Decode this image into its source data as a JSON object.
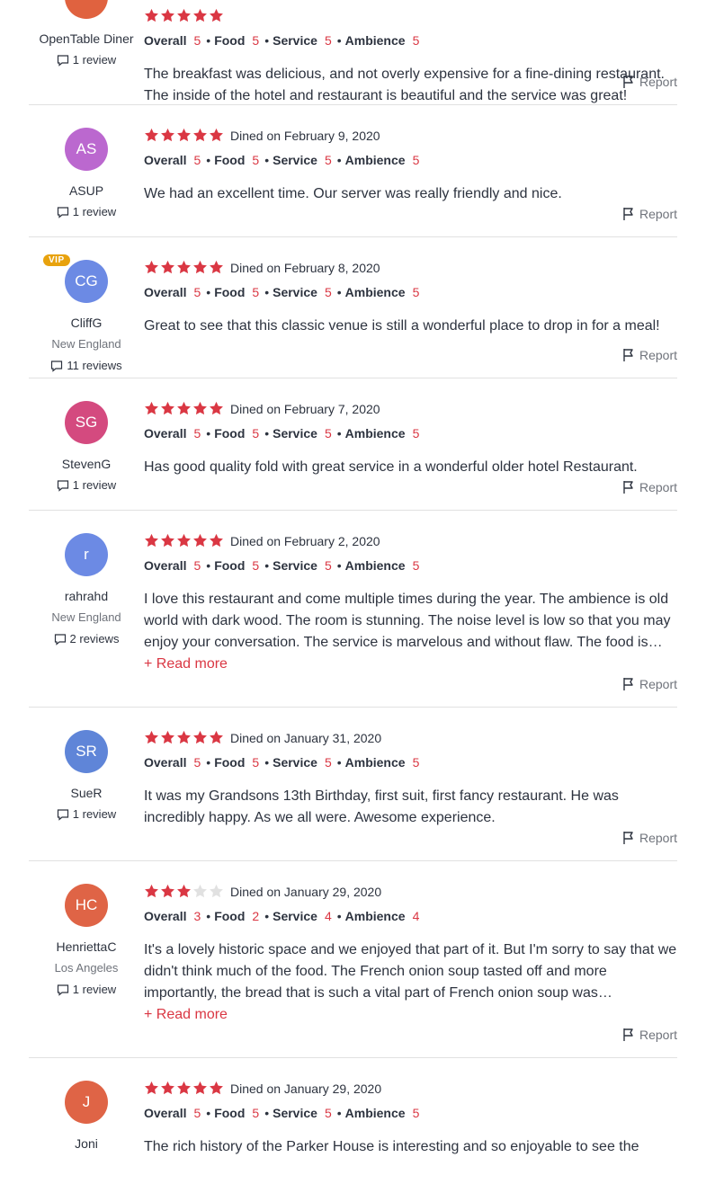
{
  "labels": {
    "overall": "Overall",
    "food": "Food",
    "service": "Service",
    "ambience": "Ambience",
    "report": "Report",
    "read_more": "+ Read more"
  },
  "colors": {
    "accent_red": "#da3743",
    "vip_gold": "#e8a20d",
    "divider": "#e1e1e1"
  },
  "reviews": [
    {
      "initials": "",
      "avatar_color": "#e0623f",
      "name": "OpenTable Diner",
      "vip": false,
      "location": "",
      "review_count": "1 review",
      "stars": 5,
      "dined": "",
      "overall": "5",
      "food": "5",
      "service": "5",
      "ambience": "5",
      "text": "The breakfast was delicious, and not overly expensive for a fine-dining restaurant. The inside of the hotel and restaurant is beautiful and the service was great!",
      "read_more": false
    },
    {
      "initials": "AS",
      "avatar_color": "#bb68cf",
      "name": "ASUP",
      "vip": false,
      "location": "",
      "review_count": "1 review",
      "stars": 5,
      "dined": "Dined on February 9, 2020",
      "overall": "5",
      "food": "5",
      "service": "5",
      "ambience": "5",
      "text": "We had an excellent time. Our server was really friendly and nice.",
      "read_more": false
    },
    {
      "initials": "CG",
      "avatar_color": "#6c8ae4",
      "name": "CliffG",
      "vip": true,
      "vip_label": "VIP",
      "location": "New England",
      "review_count": "11 reviews",
      "stars": 5,
      "dined": "Dined on February 8, 2020",
      "overall": "5",
      "food": "5",
      "service": "5",
      "ambience": "5",
      "text": "Great to see that this classic venue is still a wonderful place to drop in for a meal!",
      "read_more": false
    },
    {
      "initials": "SG",
      "avatar_color": "#d44a7f",
      "name": "StevenG",
      "vip": false,
      "location": "",
      "review_count": "1 review",
      "stars": 5,
      "dined": "Dined on February 7, 2020",
      "overall": "5",
      "food": "5",
      "service": "5",
      "ambience": "5",
      "text": "Has good quality fold with great service in a wonderful older hotel Restaurant.",
      "read_more": false
    },
    {
      "initials": "r",
      "avatar_color": "#6c8ae4",
      "name": "rahrahd",
      "vip": false,
      "location": "New England",
      "review_count": "2 reviews",
      "stars": 5,
      "dined": "Dined on February 2, 2020",
      "overall": "5",
      "food": "5",
      "service": "5",
      "ambience": "5",
      "text": "I love this restaurant and come multiple times during the year. The ambience is old world with dark wood. The room is stunning. The noise level is low so that you may enjoy your conversation. The service is marvelous and without flaw. The food is excellent and the menu has something for everyone.",
      "read_more": true
    },
    {
      "initials": "SR",
      "avatar_color": "#5f85d8",
      "name": "SueR",
      "vip": false,
      "location": "",
      "review_count": "1 review",
      "stars": 5,
      "dined": "Dined on January 31, 2020",
      "overall": "5",
      "food": "5",
      "service": "5",
      "ambience": "5",
      "text": "It was my Grandsons 13th Birthday, first suit, first fancy restaurant. He was incredibly happy. As we all were. Awesome experience.",
      "read_more": false
    },
    {
      "initials": "HC",
      "avatar_color": "#df6446",
      "name": "HenriettaC",
      "vip": false,
      "location": "Los Angeles",
      "review_count": "1 review",
      "stars": 3,
      "dined": "Dined on January 29, 2020",
      "overall": "3",
      "food": "2",
      "service": "4",
      "ambience": "4",
      "text": "It's a lovely historic space and we enjoyed that part of it. But I'm sorry to say that we didn't think much of the food. The French onion soup tasted off and more importantly, the bread that is such a vital part of French onion soup was disastrously soggy.",
      "read_more": true
    },
    {
      "initials": "J",
      "avatar_color": "#df6446",
      "name": "Joni",
      "vip": false,
      "location": "",
      "review_count": "",
      "stars": 5,
      "dined": "Dined on January 29, 2020",
      "overall": "5",
      "food": "5",
      "service": "5",
      "ambience": "5",
      "text": "The rich history of the Parker House is interesting and so enjoyable to see the",
      "read_more": false
    }
  ]
}
